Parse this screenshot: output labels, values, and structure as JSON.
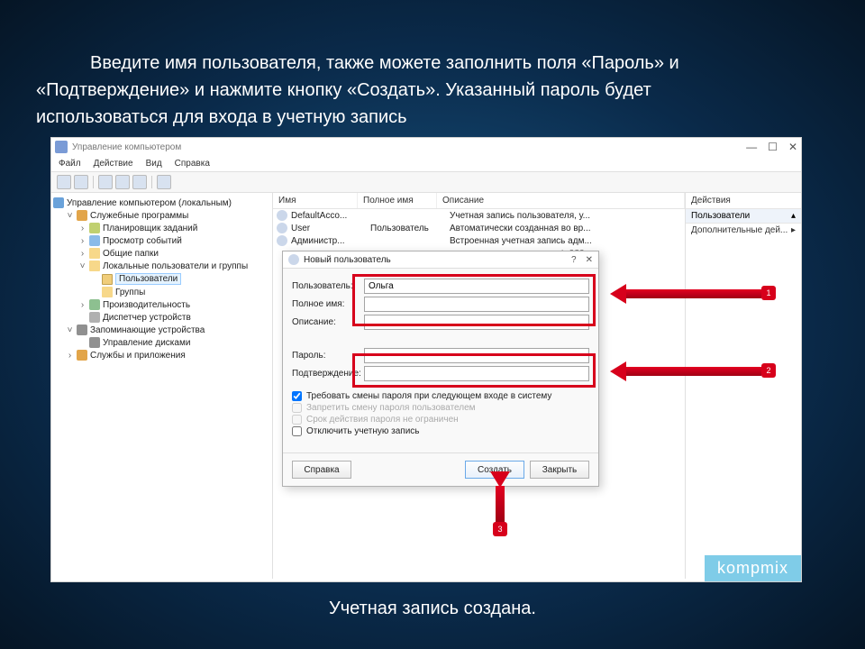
{
  "intro": {
    "line1": "Введите имя пользователя, также можете заполнить поля «Пароль» и",
    "line2": "«Подтверждение» и нажмите кнопку «Создать». Указанный пароль будет",
    "line3": "использоваться для входа в учетную запись"
  },
  "window": {
    "title": "Управление компьютером",
    "menu": [
      "Файл",
      "Действие",
      "Вид",
      "Справка"
    ],
    "win_buttons": {
      "min": "—",
      "max": "☐",
      "close": "✕"
    }
  },
  "tree": {
    "root": "Управление компьютером (локальным)",
    "tools": "Служебные программы",
    "scheduler": "Планировщик заданий",
    "events": "Просмотр событий",
    "shared": "Общие папки",
    "localusers": "Локальные пользователи и группы",
    "users": "Пользователи",
    "groups": "Группы",
    "perf": "Производительность",
    "devmgr": "Диспетчер устройств",
    "storage": "Запоминающие устройства",
    "diskmgmt": "Управление дисками",
    "services": "Службы и приложения"
  },
  "columns": {
    "name": "Имя",
    "fullname": "Полное имя",
    "desc": "Описание"
  },
  "rows": [
    {
      "name": "DefaultAcco...",
      "full": "",
      "desc": "Учетная запись пользователя, у..."
    },
    {
      "name": "User",
      "full": "Пользователь",
      "desc": "Автоматически созданная во вр..."
    },
    {
      "name": "Администр...",
      "full": "",
      "desc": "Встроенная учетная запись адм..."
    }
  ],
  "row_hidden_desc": "ь для ...",
  "dialog": {
    "title": "Новый пользователь",
    "help": "?",
    "close": "✕",
    "user_label": "Пользователь:",
    "user_value": "Ольга",
    "full_label": "Полное имя:",
    "desc_label": "Описание:",
    "pass_label": "Пароль:",
    "conf_label": "Подтверждение:",
    "chk1": "Требовать смены пароля при следующем входе в систему",
    "chk2": "Запретить смену пароля пользователем",
    "chk3": "Срок действия пароля не ограничен",
    "chk4": "Отключить учетную запись",
    "help_btn": "Справка",
    "create_btn": "Создать",
    "close_btn": "Закрыть"
  },
  "actions": {
    "header": "Действия",
    "selected": "Пользователи",
    "more": "Дополнительные дей..."
  },
  "arrows": {
    "a1": "1",
    "a2": "2",
    "a3": "3"
  },
  "watermark": "kompmix",
  "outro": "Учетная запись создана."
}
